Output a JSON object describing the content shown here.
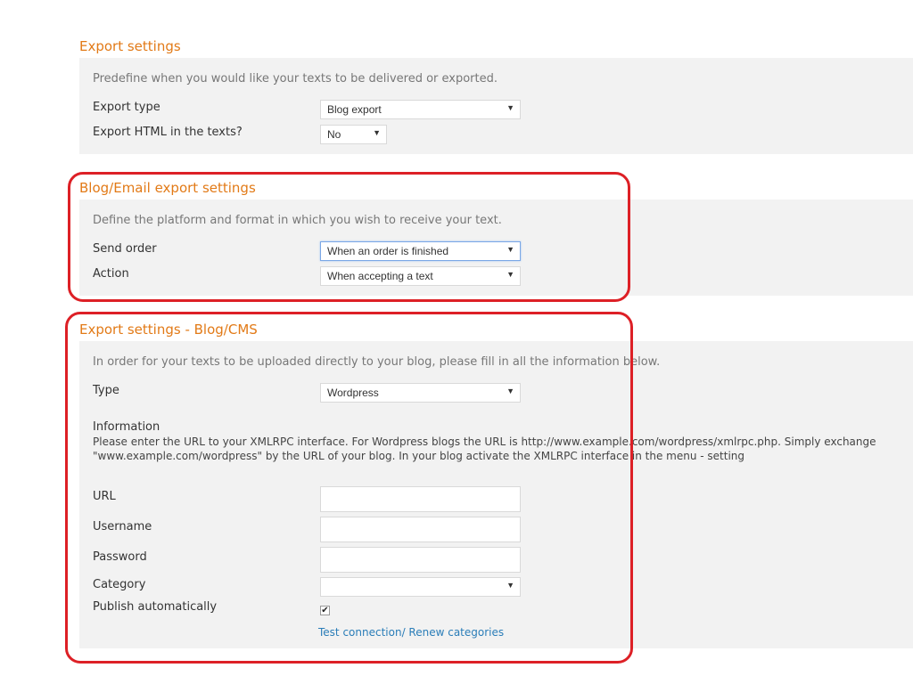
{
  "export_settings": {
    "title": "Export settings",
    "description": "Predefine when you would like your texts to be delivered or exported.",
    "export_type": {
      "label": "Export type",
      "value": "Blog export"
    },
    "export_html": {
      "label": "Export HTML in the texts?",
      "value": "No"
    }
  },
  "blog_email": {
    "title": "Blog/Email export settings",
    "description": "Define the platform and format in which you wish to receive your text.",
    "send_order": {
      "label": "Send order",
      "value": "When an order is finished"
    },
    "action": {
      "label": "Action",
      "value": "When accepting a text"
    }
  },
  "blog_cms": {
    "title": "Export settings - Blog/CMS",
    "description": "In order for your texts to be uploaded directly to your blog, please fill in all the information below.",
    "type": {
      "label": "Type",
      "value": "Wordpress"
    },
    "information": {
      "heading": "Information",
      "text": "Please enter the URL to your XMLRPC interface. For Wordpress blogs the URL is http://www.example.com/wordpress/xmlrpc.php. Simply exchange \"www.example.com/wordpress\" by the URL of your blog. In your blog activate the XMLRPC interface in the menu - setting"
    },
    "url": {
      "label": "URL",
      "value": ""
    },
    "username": {
      "label": "Username",
      "value": ""
    },
    "password": {
      "label": "Password",
      "value": ""
    },
    "category": {
      "label": "Category",
      "value": ""
    },
    "publish": {
      "label": "Publish automatically",
      "checked": true,
      "check_glyph": "✔"
    },
    "test_link": "Test connection/ Renew categories"
  },
  "icons": {
    "dropdown_arrow": "▼"
  },
  "colors": {
    "section_title": "#e27a17",
    "panel_bg": "#f2f2f2",
    "highlight_border": "#dd2026",
    "link": "#2a7db8"
  }
}
